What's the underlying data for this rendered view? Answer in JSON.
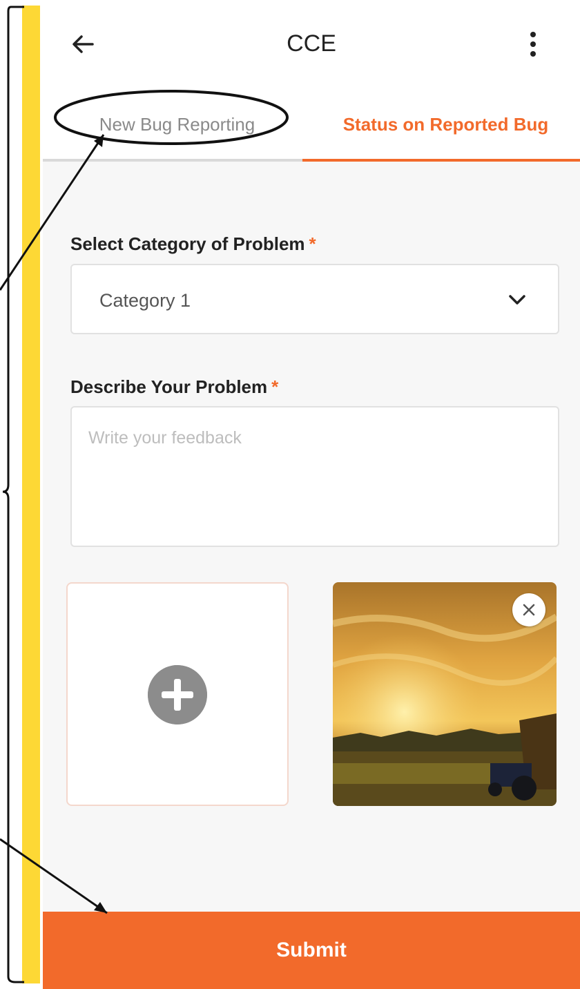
{
  "appbar": {
    "title": "CCE",
    "back_icon": "arrow-left-icon",
    "more_icon": "more-vert-icon"
  },
  "tabs": [
    {
      "label": "New Bug Reporting",
      "active": false
    },
    {
      "label": "Status on Reported Bug",
      "active": true
    }
  ],
  "form": {
    "category": {
      "label": "Select Category of Problem",
      "required_mark": "*",
      "selected_value": "Category 1"
    },
    "description": {
      "label": "Describe Your Problem",
      "required_mark": "*",
      "placeholder": "Write your feedback",
      "value": ""
    }
  },
  "attachments": {
    "add_icon": "plus-circle-icon",
    "photo_remove_icon": "close-icon"
  },
  "submit": {
    "label": "Submit"
  },
  "colors": {
    "accent": "#f26a2b",
    "bracket": "#fdd835",
    "background": "#f7f7f7"
  }
}
